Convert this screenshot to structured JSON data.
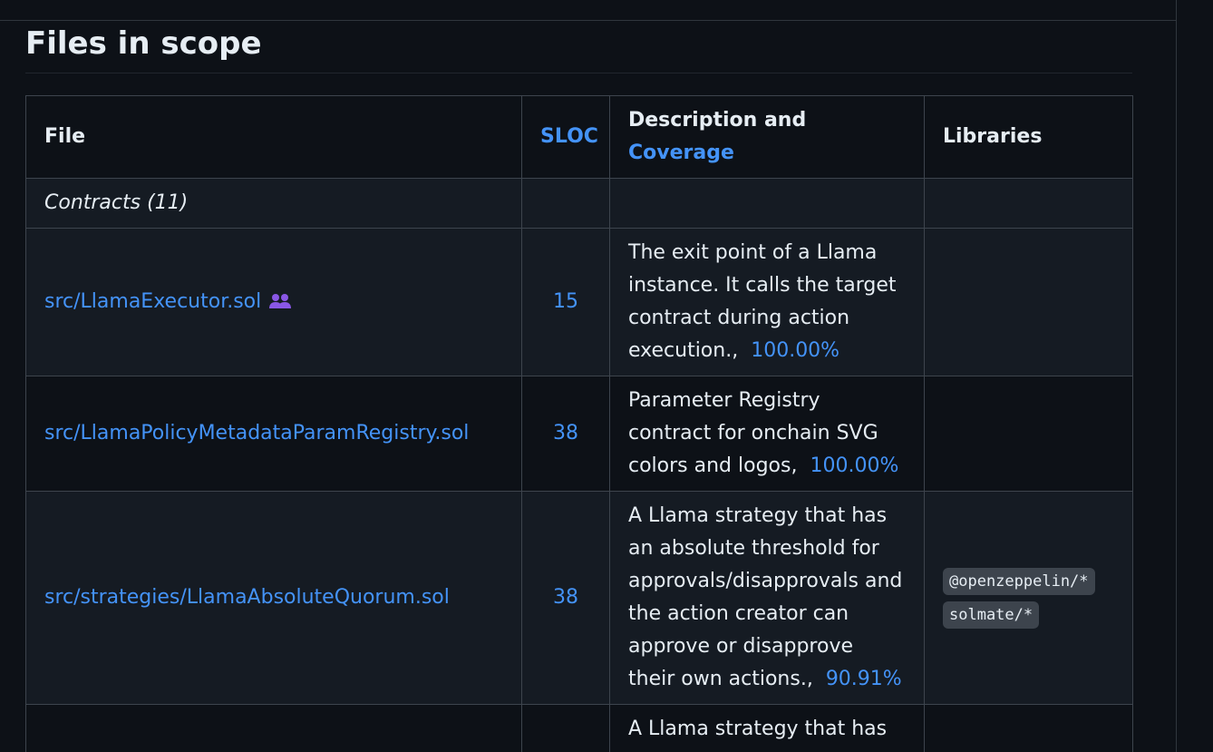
{
  "heading": "Files in scope",
  "table": {
    "headers": {
      "file": "File",
      "sloc": "SLOC",
      "description_prefix": "Description and ",
      "coverage": "Coverage",
      "libraries": "Libraries"
    },
    "group_label": "Contracts (11)",
    "rows": [
      {
        "file": "src/LlamaExecutor.sol",
        "icon": "people-icon",
        "sloc": "15",
        "description": "The exit point of a Llama instance. It calls the target contract during action execution.,",
        "coverage": "100.00%",
        "libraries": []
      },
      {
        "file": "src/LlamaPolicyMetadataParamRegistry.sol",
        "sloc": "38",
        "description": "Parameter Registry contract for onchain SVG colors and logos,",
        "coverage": "100.00%",
        "libraries": []
      },
      {
        "file": "src/strategies/LlamaAbsoluteQuorum.sol",
        "sloc": "38",
        "description": "A Llama strategy that has an absolute threshold for approvals/disapprovals and the action creator can approve or disapprove their own actions.,",
        "coverage": "90.91%",
        "libraries": [
          "@openzeppelin/*",
          "solmate/*"
        ]
      },
      {
        "file": "",
        "sloc": "",
        "description": "A Llama strategy that has an absolute threshold for",
        "coverage": "",
        "libraries": []
      }
    ]
  },
  "colors": {
    "background": "#0d1117",
    "row_alt": "#151b23",
    "border": "#3d444d",
    "link": "#4493f8",
    "text": "#e6edf3",
    "icon": "#8957e5"
  }
}
